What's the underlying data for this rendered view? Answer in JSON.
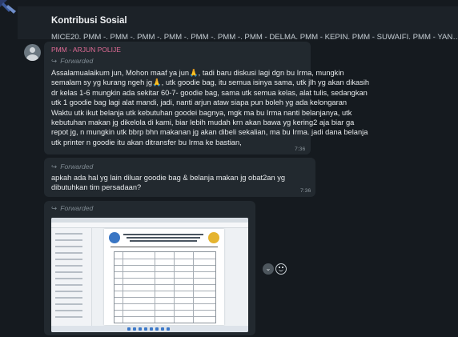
{
  "header": {
    "title": "Kontribusi Sosial",
    "members": "MICE20, PMM -, PMM -, PMM -, PMM -, PMM -, PMM -, PMM - DELMA, PMM - KEPIN, PMM - SUWAIFI, PMM - YAN…"
  },
  "messages": [
    {
      "sender": "PMM - ARJUN POLIJE",
      "forwarded_label": "Forwarded",
      "lines": [
        "Assalamualaikum jun, Mohon maaf ya jun🙏, tadi baru diskusi lagi dgn bu Irma, mungkin",
        "semalam sy yg kurang ngeh jg🙏, utk goodie bag, itu semua isinya sama, utk jlh yg akan dikasih",
        "dr kelas 1-6 mungkin ada sekitar 60-7- goodie bag, sama utk semua kelas, alat tulis, sedangkan",
        "utk 1 goodie bag lagi alat mandi, jadi, nanti arjun ataw siapa pun boleh yg ada kelongaran",
        "Waktu utk ikut belanja utk kebutuhan goodei bagnya, mgk ma bu Irma nanti belanjanya, utk",
        "kebutuhan makan jg dikelola di kami, biar lebih mudah krn akan bawa yg kering2 aja biar ga",
        "repot jg, n mungkin utk bbrp bhn makanan jg akan dibeli sekalian, ma bu Irma. jadi dana belanja",
        "utk printer n goodie itu akan ditransfer bu Irma ke bastian,"
      ],
      "time": "7:36"
    },
    {
      "forwarded_label": "Forwarded",
      "lines": [
        "apkah  ada hal yg lain diluar goodie bag & belanja makan jg obat2an yg",
        "dibutuhkan tim persadaan?"
      ],
      "time": "7:36"
    },
    {
      "forwarded_label": "Forwarded",
      "image": "document-screenshot"
    }
  ],
  "icons": {
    "forward": "forward-arrow-icon",
    "chevron": "chevron-down-icon",
    "emoji": "emoji-smile-icon"
  },
  "colors": {
    "background": "#151a1f",
    "bubble": "#22292f",
    "sender": "#e06b95"
  }
}
